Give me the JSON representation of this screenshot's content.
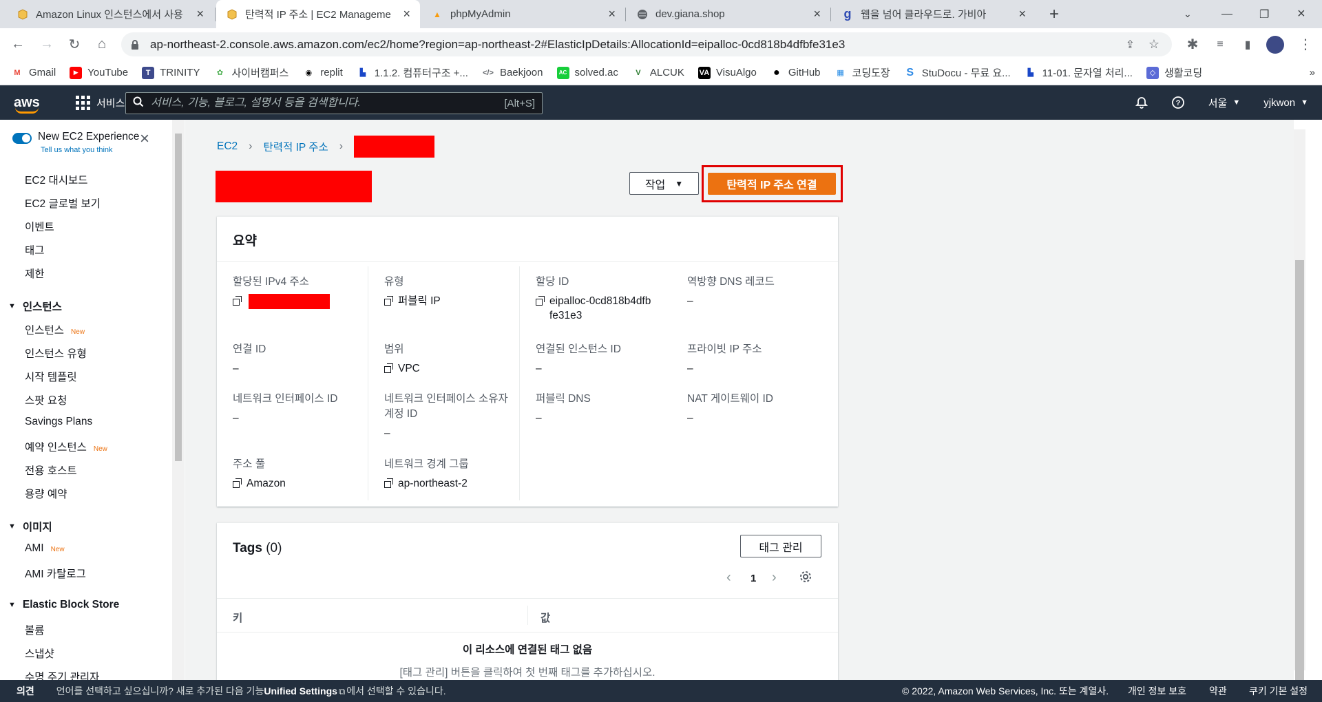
{
  "browser": {
    "tabs": [
      {
        "title": "Amazon Linux 인스턴스에서 사용",
        "active": false,
        "icon": "aws-box-icon"
      },
      {
        "title": "탄력적 IP 주소 | EC2 Manageme",
        "active": true,
        "icon": "aws-box-icon"
      },
      {
        "title": "phpMyAdmin",
        "active": false,
        "icon": "phpmyadmin-icon"
      },
      {
        "title": "dev.giana.shop",
        "active": false,
        "icon": "globe-icon"
      },
      {
        "title": "웹을 넘어 클라우드로. 가비아",
        "active": false,
        "icon": "gabia-icon"
      }
    ],
    "url": "ap-northeast-2.console.aws.amazon.com/ec2/home?region=ap-northeast-2#ElasticIpDetails:AllocationId=eipalloc-0cd818b4dfbfe31e3",
    "bookmarks": [
      "Gmail",
      "YouTube",
      "TRINITY",
      "사이버캠퍼스",
      "replit",
      "1.1.2. 컴퓨터구조 +...",
      "Baekjoon",
      "solved.ac",
      "ALCUK",
      "VisuAlgo",
      "GitHub",
      "코딩도장",
      "StuDocu - 무료 요...",
      "11-01. 문자열 처리...",
      "생활코딩"
    ]
  },
  "aws": {
    "logo": "aws",
    "services": "서비스",
    "search_placeholder": "서비스, 기능, 블로그, 설명서 등을 검색합니다.",
    "search_shortcut": "[Alt+S]",
    "region": "서울",
    "user": "yjkwon"
  },
  "sidebar": {
    "new_exp_title": "New EC2 Experience",
    "new_exp_sub": "Tell us what you think",
    "top_items": [
      "EC2 대시보드",
      "EC2 글로벌 보기",
      "이벤트",
      "태그",
      "제한"
    ],
    "sections": [
      {
        "title": "인스턴스",
        "items": [
          {
            "label": "인스턴스",
            "new": "New"
          },
          {
            "label": "인스턴스 유형",
            "new": ""
          },
          {
            "label": "시작 템플릿",
            "new": ""
          },
          {
            "label": "스팟 요청",
            "new": ""
          },
          {
            "label": "Savings Plans",
            "new": ""
          },
          {
            "label": "예약 인스턴스",
            "new": "New"
          },
          {
            "label": "전용 호스트",
            "new": ""
          },
          {
            "label": "용량 예약",
            "new": ""
          }
        ]
      },
      {
        "title": "이미지",
        "items": [
          {
            "label": "AMI",
            "new": "New"
          },
          {
            "label": "AMI 카탈로그",
            "new": ""
          }
        ]
      },
      {
        "title": "Elastic Block Store",
        "items": [
          {
            "label": "볼륨",
            "new": ""
          },
          {
            "label": "스냅샷",
            "new": ""
          },
          {
            "label": "수명 주기 관리자",
            "new": ""
          }
        ]
      }
    ]
  },
  "breadcrumb": {
    "ec2": "EC2",
    "eip": "탄력적 IP 주소"
  },
  "actions": {
    "menu": "작업",
    "associate": "탄력적 IP 주소 연결"
  },
  "summary": {
    "title": "요약",
    "fields": {
      "ipv4": {
        "k": "할당된 IPv4 주소",
        "v": ""
      },
      "type": {
        "k": "유형",
        "v": "퍼블릭 IP"
      },
      "alloc": {
        "k": "할당 ID",
        "v": "eipalloc-0cd818b4dfbfe31e3"
      },
      "rdns": {
        "k": "역방향 DNS 레코드",
        "v": "–"
      },
      "assoc": {
        "k": "연결 ID",
        "v": "–"
      },
      "scope": {
        "k": "범위",
        "v": "VPC"
      },
      "inst": {
        "k": "연결된 인스턴스 ID",
        "v": "–"
      },
      "privip": {
        "k": "프라이빗 IP 주소",
        "v": "–"
      },
      "eni": {
        "k": "네트워크 인터페이스 ID",
        "v": "–"
      },
      "eniowner": {
        "k": "네트워크 인터페이스 소유자 계정 ID",
        "v": "–"
      },
      "pubdns": {
        "k": "퍼블릭 DNS",
        "v": "–"
      },
      "nat": {
        "k": "NAT 게이트웨이 ID",
        "v": "–"
      },
      "pool": {
        "k": "주소 풀",
        "v": "Amazon"
      },
      "border": {
        "k": "네트워크 경계 그룹",
        "v": "ap-northeast-2"
      }
    }
  },
  "tags": {
    "title": "Tags",
    "count": "(0)",
    "manage": "태그 관리",
    "page": "1",
    "col_key": "키",
    "col_value": "값",
    "empty_title": "이 리소스에 연결된 태그 없음",
    "empty_desc": "[태그 관리] 버튼을 클릭하여 첫 번째 태그를 추가하십시오."
  },
  "footer": {
    "feedback": "의견",
    "lang_pre": "언어를 선택하고 싶으십니까? 새로 추가된 다음 기능",
    "unified": "Unified Settings",
    "lang_post": "에서 선택할 수 있습니다.",
    "copyright": "© 2022, Amazon Web Services, Inc. 또는 계열사.",
    "privacy": "개인 정보 보호",
    "terms": "약관",
    "cookies": "쿠키 기본 설정"
  }
}
